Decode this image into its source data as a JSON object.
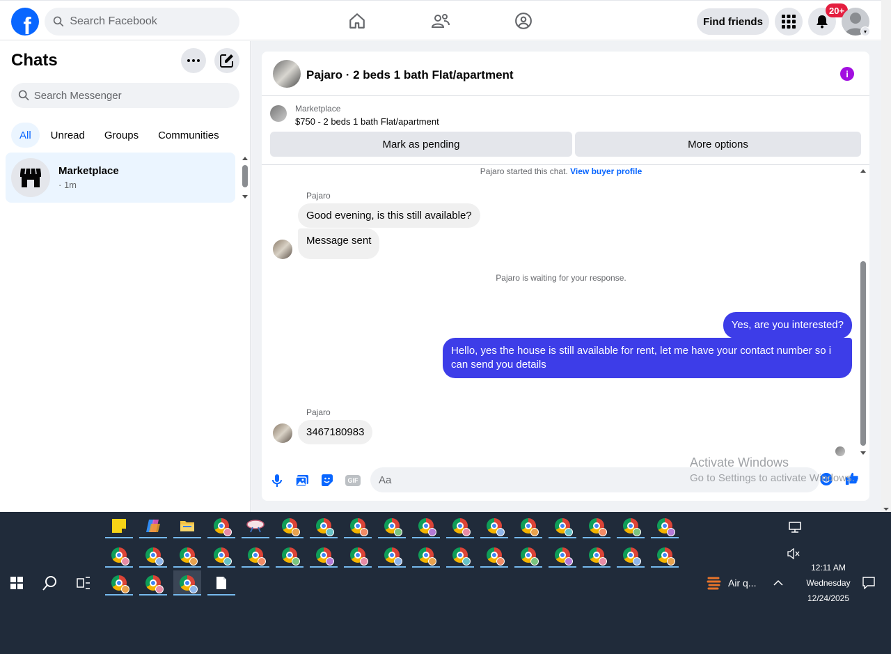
{
  "topnav": {
    "logo": "f",
    "search_placeholder": "Search Facebook",
    "find_friends": "Find friends",
    "notifications_badge": "20+"
  },
  "sidebar": {
    "title": "Chats",
    "search_placeholder": "Search Messenger",
    "filters": [
      "All",
      "Unread",
      "Groups",
      "Communities"
    ],
    "active_filter": "All",
    "chats": [
      {
        "name": "Marketplace",
        "time": "· 1m"
      }
    ]
  },
  "conversation": {
    "title": "Pajaro · 2 beds 1 bath Flat/apartment",
    "listing": {
      "kicker": "Marketplace",
      "title": "$750 - 2 beds 1 bath Flat/apartment",
      "mark_pending": "Mark as pending",
      "more_options": "More options"
    },
    "started_text": "Pajaro started this chat.",
    "view_profile": "View buyer profile",
    "waiting_text": "Pajaro is waiting for your response.",
    "messages": {
      "sender1": "Pajaro",
      "in1": "Good evening, is this still available?",
      "in2": "Message sent",
      "out1": "Yes, are you interested?",
      "out2": "Hello, yes the house is still available for rent, let me have your contact number so i can send you details",
      "sender2": "Pajaro",
      "in3": "3467180983"
    },
    "composer_placeholder": "Aa",
    "gif_label": "GIF"
  },
  "watermark": {
    "line1": "Activate Windows",
    "line2": "Go to Settings to activate Windows."
  },
  "taskbar": {
    "weather": "Air q...",
    "time": "12:11 AM",
    "day": "Wednesday",
    "date": "12/24/2025"
  },
  "colors": {
    "brand": "#0866ff",
    "outgoing_bubble": "#3d3de8",
    "badge": "#e41e3f",
    "taskbar": "#202b3a"
  }
}
